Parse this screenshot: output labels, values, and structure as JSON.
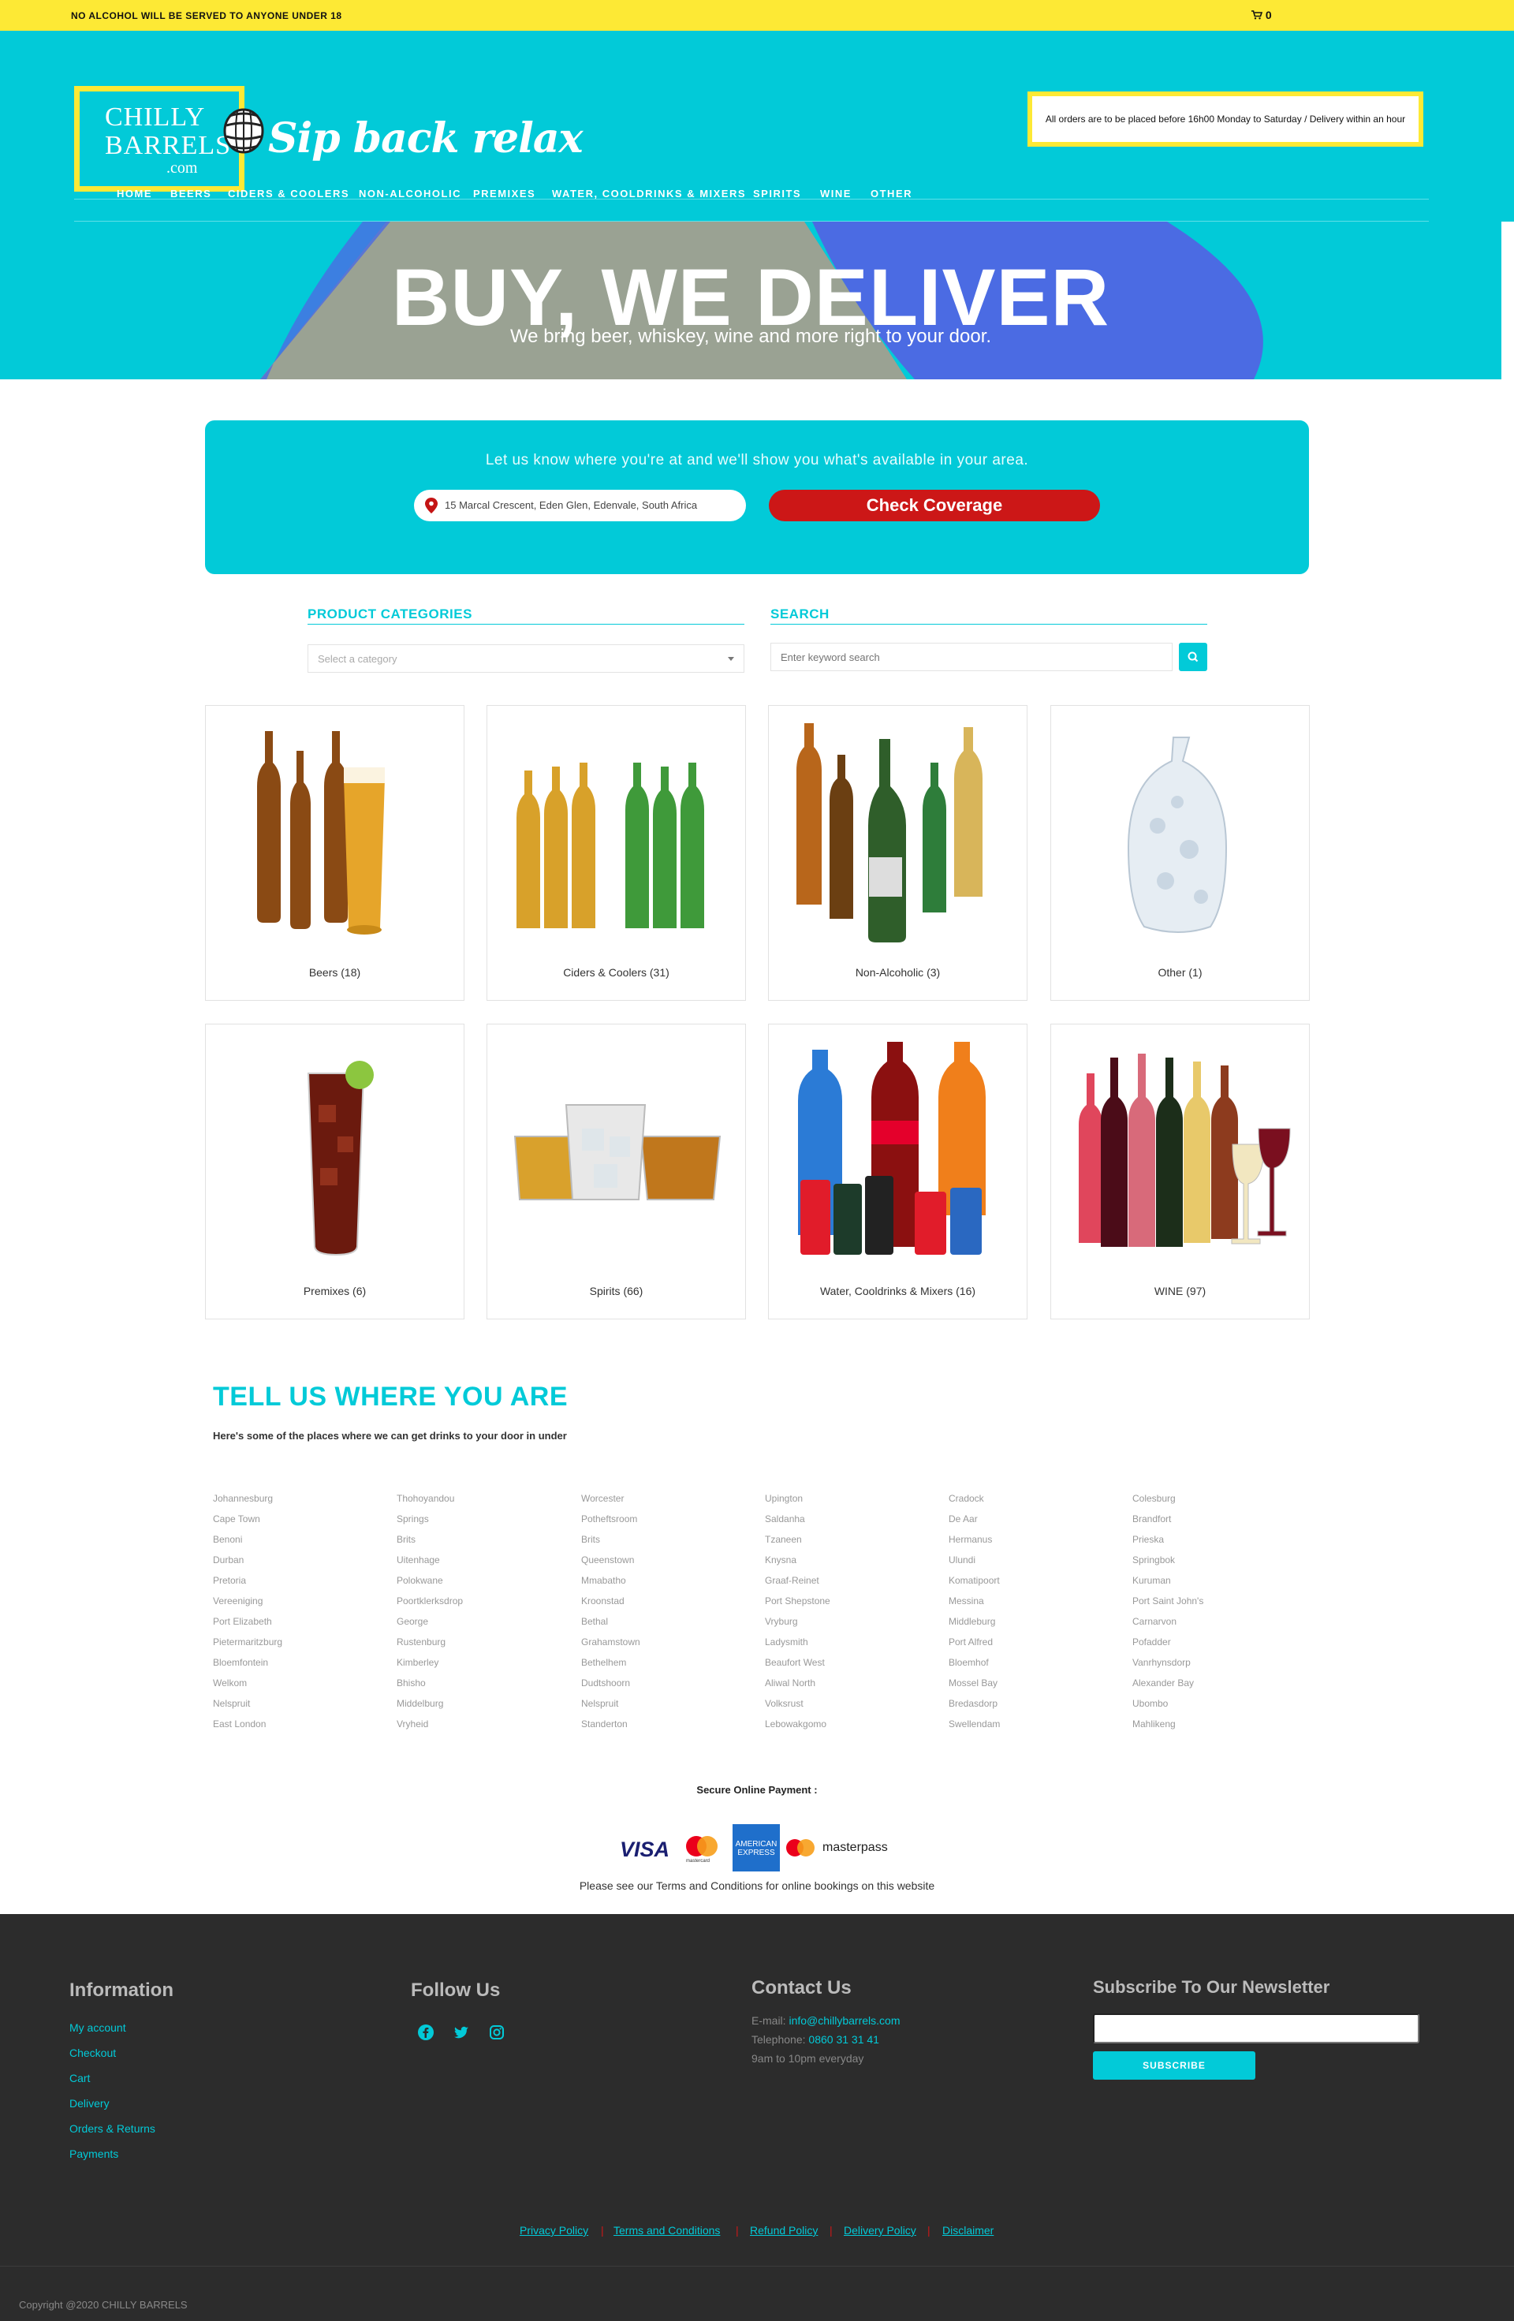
{
  "topbar": {
    "warning": "NO ALCOHOL WILL BE SERVED TO ANYONE UNDER 18",
    "cart_count": "0"
  },
  "header": {
    "logo": {
      "line1": "CHILLY",
      "line2": "BARRELS",
      "line3": ".com"
    },
    "tagline": "Sip back relax",
    "notice": "All orders are to be placed before 16h00 Monday to Saturday / Delivery within an hour"
  },
  "nav": [
    "HOME",
    "BEERS",
    "CIDERS & COOLERS",
    "NON-ALCOHOLIC",
    "PREMIXES",
    "WATER, COOLDRINKS & MIXERS",
    "SPIRITS",
    "WINE",
    "OTHER"
  ],
  "hero": {
    "title": "BUY, WE DELIVER",
    "subtitle": "We bring beer, whiskey, wine and more right to your door."
  },
  "coverage": {
    "lead": "Let us know where you're at and we'll show you what's available in your area.",
    "address": "15 Marcal Crescent, Eden Glen, Edenvale, South Africa",
    "button": "Check Coverage"
  },
  "filters": {
    "categories_label": "PRODUCT CATEGORIES",
    "category_placeholder": "Select a category",
    "search_label": "SEARCH",
    "search_placeholder": "Enter keyword search"
  },
  "categories": [
    {
      "label": "Beers (18)"
    },
    {
      "label": "Ciders & Coolers (31)"
    },
    {
      "label": "Non-Alcoholic (3)"
    },
    {
      "label": "Other (1)"
    },
    {
      "label": "Premixes (6)"
    },
    {
      "label": "Spirits (66)"
    },
    {
      "label": "Water, Cooldrinks & Mixers (16)"
    },
    {
      "label": "WINE (97)"
    }
  ],
  "where": {
    "title": "TELL US WHERE YOU ARE",
    "subtitle": "Here's some of the places where we can get drinks to your door in under",
    "columns": [
      [
        "Johannesburg",
        "Cape Town",
        "Benoni",
        "Durban",
        "Pretoria",
        "Vereeniging",
        "Port Elizabeth",
        "Pietermaritzburg",
        "Bloemfontein",
        "Welkom",
        "Nelspruit",
        "East London"
      ],
      [
        "Thohoyandou",
        "Springs",
        "Brits",
        "Uitenhage",
        "Polokwane",
        "Poortklerksdrop",
        "George",
        "Rustenburg",
        "Kimberley",
        "Bhisho",
        "Middelburg",
        "Vryheid"
      ],
      [
        "Worcester",
        "Potheftsroom",
        "Brits",
        "Queenstown",
        "Mmabatho",
        "Kroonstad",
        "Bethal",
        "Grahamstown",
        "Bethelhem",
        "Dudtshoorn",
        "Nelspruit",
        "Standerton"
      ],
      [
        "Upington",
        "Saldanha",
        "Tzaneen",
        "Knysna",
        "Graaf-Reinet",
        "Port Shepstone",
        "Vryburg",
        "Ladysmith",
        "Beaufort West",
        "Aliwal North",
        "Volksrust",
        "Lebowakgomo"
      ],
      [
        "Cradock",
        "De Aar",
        "Hermanus",
        "Ulundi",
        "Komatipoort",
        "Messina",
        "Middleburg",
        "Port Alfred",
        "Bloemhof",
        "Mossel Bay",
        "Bredasdorp",
        "Swellendam"
      ],
      [
        "Colesburg",
        "Brandfort",
        "Prieska",
        "Springbok",
        "Kuruman",
        "Port Saint John's",
        "Carnarvon",
        "Pofadder",
        "Vanrhynsdorp",
        "Alexander Bay",
        "Ubombo",
        "Mahlikeng"
      ]
    ]
  },
  "payment": {
    "heading": "Secure Online Payment :",
    "logos": {
      "visa": "VISA",
      "mastercard": "mastercard",
      "amex_1": "AMERICAN",
      "amex_2": "EXPRESS",
      "masterpass": "masterpass"
    },
    "terms": "Please see our Terms and Conditions for online bookings on this website"
  },
  "footer": {
    "information": {
      "title": "Information",
      "links": [
        "My account",
        "Checkout",
        "Cart",
        "Delivery",
        "Orders & Returns",
        "Payments"
      ]
    },
    "follow": {
      "title": "Follow Us"
    },
    "contact": {
      "title": "Contact Us",
      "email_label": "E-mail:",
      "email": "info@chillybarrels.com",
      "phone_label": "Telephone:",
      "phone": "0860 31 31 41",
      "hours": "9am to 10pm everyday"
    },
    "newsletter": {
      "title": "Subscribe To Our Newsletter",
      "button": "SUBSCRIBE"
    },
    "bottom_links": [
      "Privacy Policy",
      "Terms and Conditions",
      "Refund Policy",
      "Delivery Policy",
      "Disclaimer"
    ],
    "copyright": "Copyright @2020 CHILLY BARRELS"
  },
  "colors": {
    "brand": "#02cad8",
    "accent": "#fde935",
    "cta": "#cc1717",
    "footer": "#2c2c2c"
  },
  "icons": [
    "cart-icon",
    "barrel-icon",
    "map-pin-icon",
    "search-icon",
    "facebook-icon",
    "twitter-icon",
    "instagram-icon"
  ]
}
